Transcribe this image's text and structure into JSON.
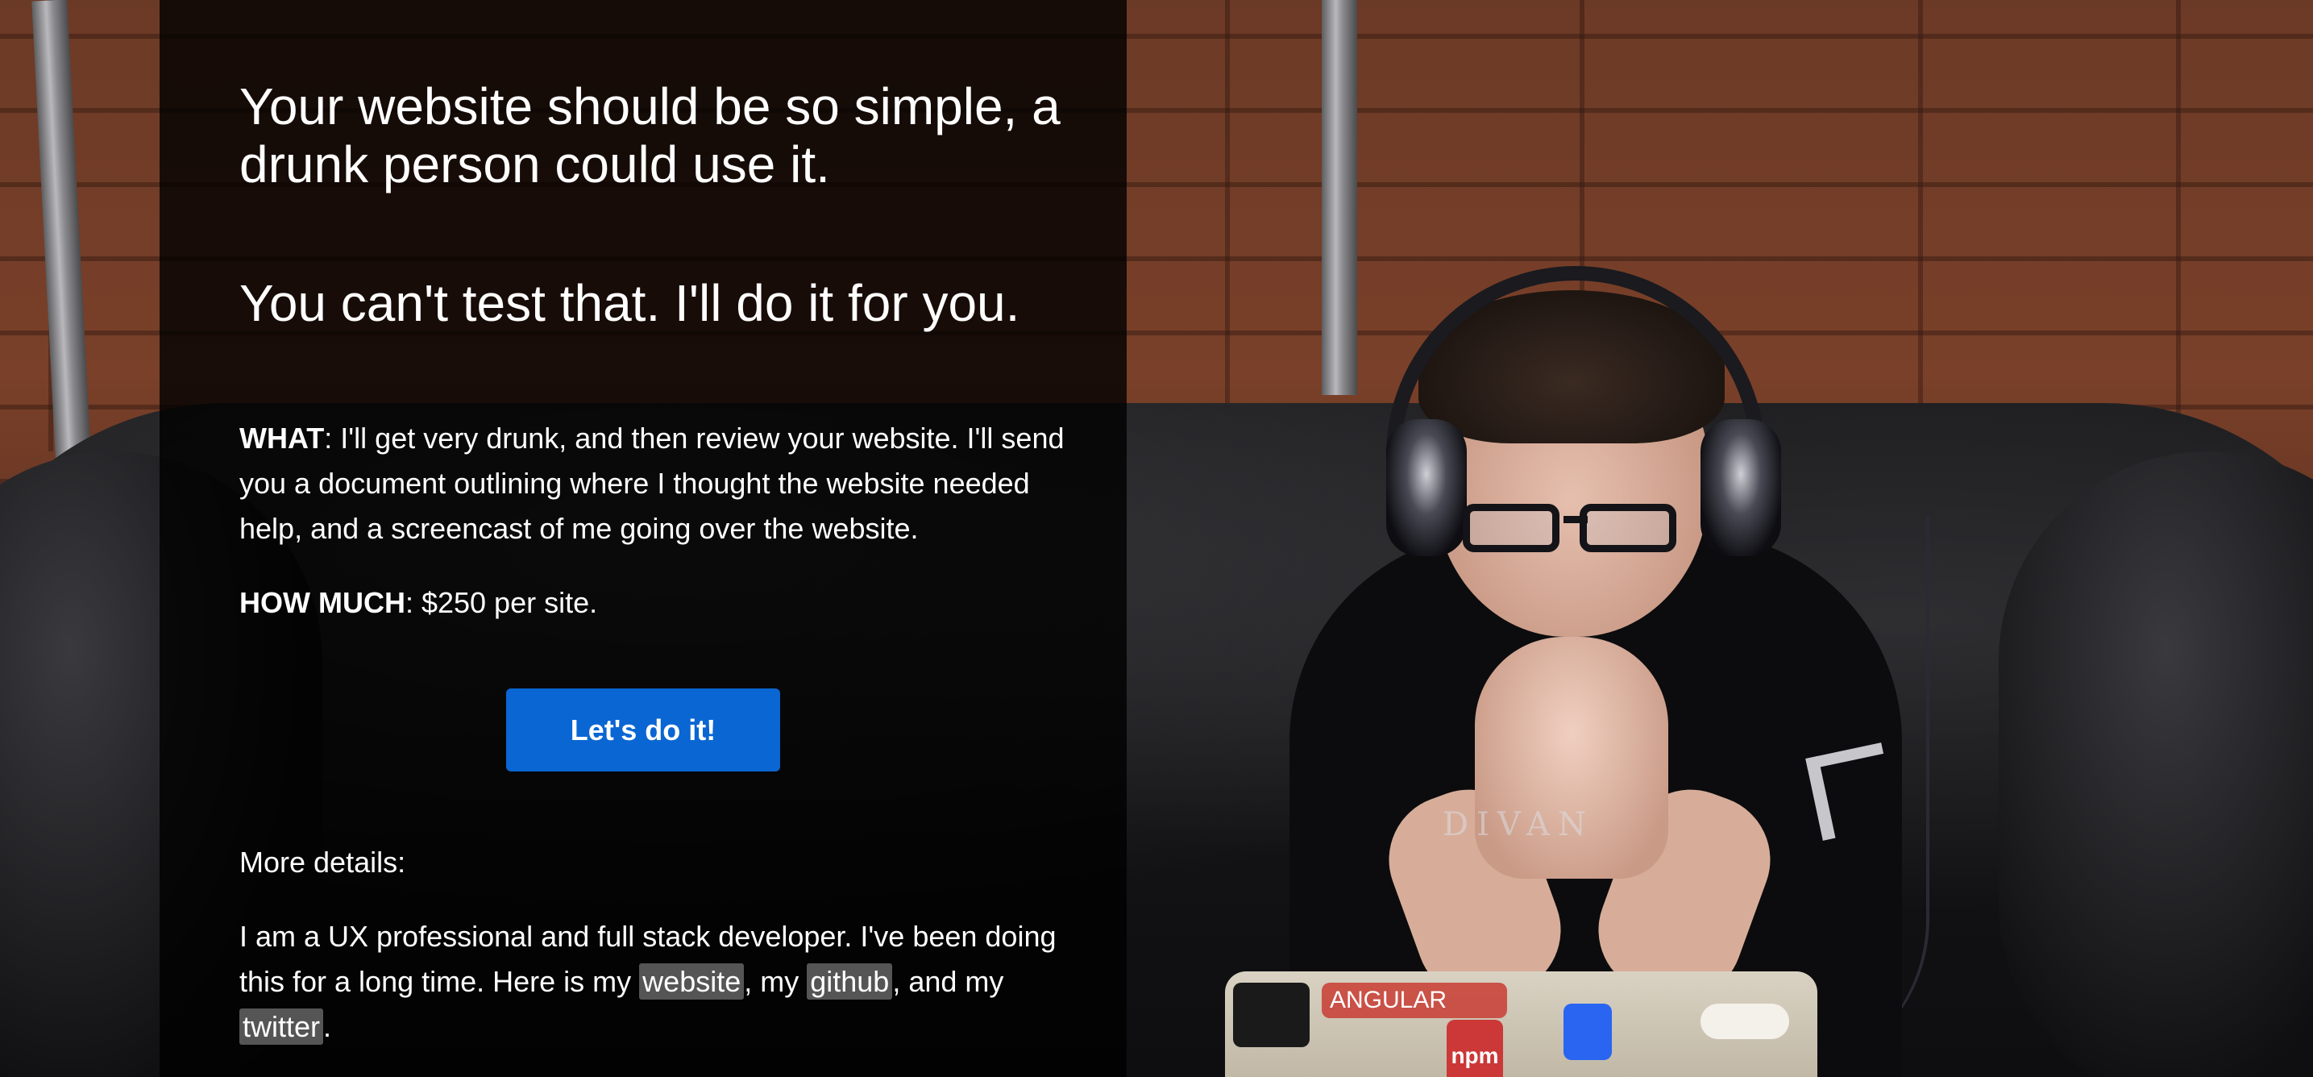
{
  "hero": {
    "headline_1": "Your website should be so simple, a drunk person could use it.",
    "headline_2": "You can't test that. I'll do it for you."
  },
  "offer": {
    "what_label": "WHAT",
    "what_text": ": I'll get very drunk, and then review your website. I'll send you a document outlining where I thought the website needed help, and a screencast of me going over the website.",
    "how_much_label": "HOW MUCH",
    "how_much_text": ": $250 per site."
  },
  "cta": {
    "label": "Let's do it!"
  },
  "details": {
    "heading": "More details:",
    "intro": "I am a UX professional and full stack developer. I've been doing this for a long time. Here is my ",
    "link_website": "website",
    "sep_1": ", my ",
    "link_github": "github",
    "sep_2": ", and my ",
    "link_twitter": "twitter",
    "end": "."
  },
  "background": {
    "shirt_text": "DIVAN",
    "laptop_sticker": "ANGULAR",
    "laptop_sticker_2": "npm"
  },
  "colors": {
    "accent": "#0a66d2",
    "panel_overlay": "rgba(0,0,0,0.8)",
    "link_chip": "#555555"
  }
}
